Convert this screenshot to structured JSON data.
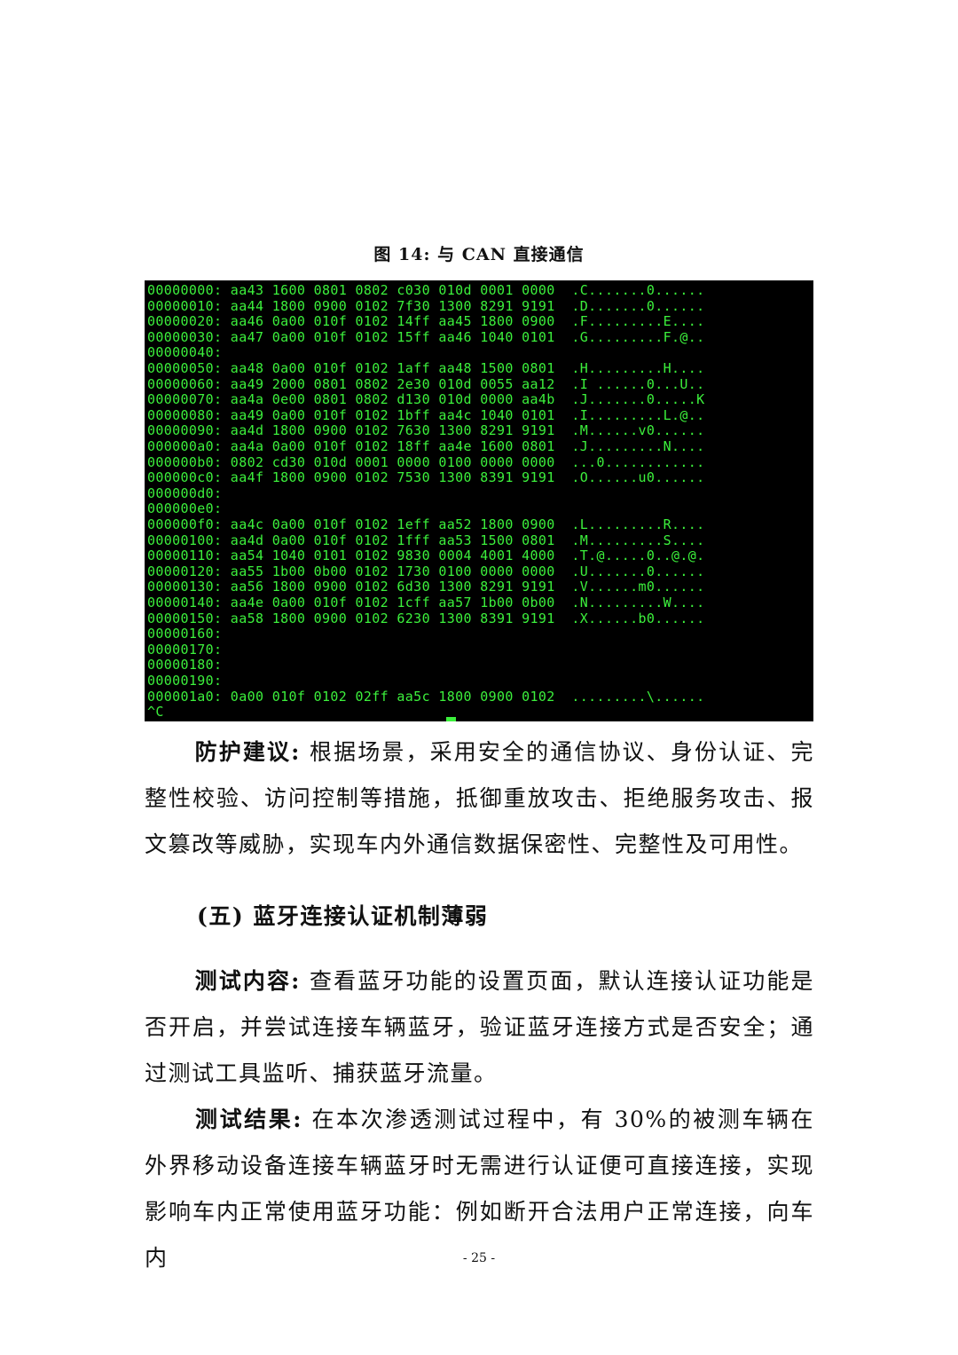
{
  "figure": {
    "caption": "图 14: 与 CAN 直接通信"
  },
  "terminal": {
    "lines": [
      "00000000: aa43 1600 0801 0802 c030 010d 0001 0000  .C.......0......",
      "00000010: aa44 1800 0900 0102 7f30 1300 8291 9191  .D.......0......",
      "00000020: aa46 0a00 010f 0102 14ff aa45 1800 0900  .F.........E....",
      "00000030: aa47 0a00 010f 0102 15ff aa46 1040 0101  .G.........F.@..",
      "00000040:",
      "00000050: aa48 0a00 010f 0102 1aff aa48 1500 0801  .H.........H....",
      "00000060: aa49 2000 0801 0802 2e30 010d 0055 aa12  .I ......0...U..",
      "00000070: aa4a 0e00 0801 0802 d130 010d 0000 aa4b  .J.......0.....K",
      "00000080: aa49 0a00 010f 0102 1bff aa4c 1040 0101  .I.........L.@..",
      "00000090: aa4d 1800 0900 0102 7630 1300 8291 9191  .M......v0......",
      "000000a0: aa4a 0a00 010f 0102 18ff aa4e 1600 0801  .J.........N....",
      "000000b0: 0802 cd30 010d 0001 0000 0100 0000 0000  ...0............",
      "000000c0: aa4f 1800 0900 0102 7530 1300 8391 9191  .O......u0......",
      "000000d0:",
      "000000e0:",
      "000000f0: aa4c 0a00 010f 0102 1eff aa52 1800 0900  .L.........R....",
      "00000100: aa4d 0a00 010f 0102 1fff aa53 1500 0801  .M.........S....",
      "00000110: aa54 1040 0101 0102 9830 0004 4001 4000  .T.@.....0..@.@.",
      "00000120: aa55 1b00 0b00 0102 1730 0100 0000 0000  .U.......0......",
      "00000130: aa56 1800 0900 0102 6d30 1300 8291 9191  .V......m0......",
      "00000140: aa4e 0a00 010f 0102 1cff aa57 1b00 0b00  .N.........W....",
      "00000150: aa58 1800 0900 0102 6230 1300 8391 9191  .X......b0......",
      "00000160:",
      "00000170:",
      "00000180:",
      "00000190:",
      "000001a0: 0a00 010f 0102 02ff aa5c 1800 0900 0102  .........\\......",
      "^C"
    ]
  },
  "paragraphs": {
    "p1": {
      "lead": "防护建议:",
      "body": " 根据场景，采用安全的通信协议、身份认证、完整性校验、访问控制等措施，抵御重放攻击、拒绝服务攻击、报文篡改等威胁，实现车内外通信数据保密性、完整性及可用性。"
    },
    "heading": "(五) 蓝牙连接认证机制薄弱",
    "p2": {
      "lead": "测试内容:",
      "body": " 查看蓝牙功能的设置页面，默认连接认证功能是否开启，并尝试连接车辆蓝牙，验证蓝牙连接方式是否安全；通过测试工具监听、捕获蓝牙流量。"
    },
    "p3": {
      "lead": "测试结果:",
      "body": " 在本次渗透测试过程中，有 30%的被测车辆在外界移动设备连接车辆蓝牙时无需进行认证便可直接连接，实现影响车内正常使用蓝牙功能：例如断开合法用户正常连接，向车内"
    }
  },
  "page_number": "- 25 -"
}
